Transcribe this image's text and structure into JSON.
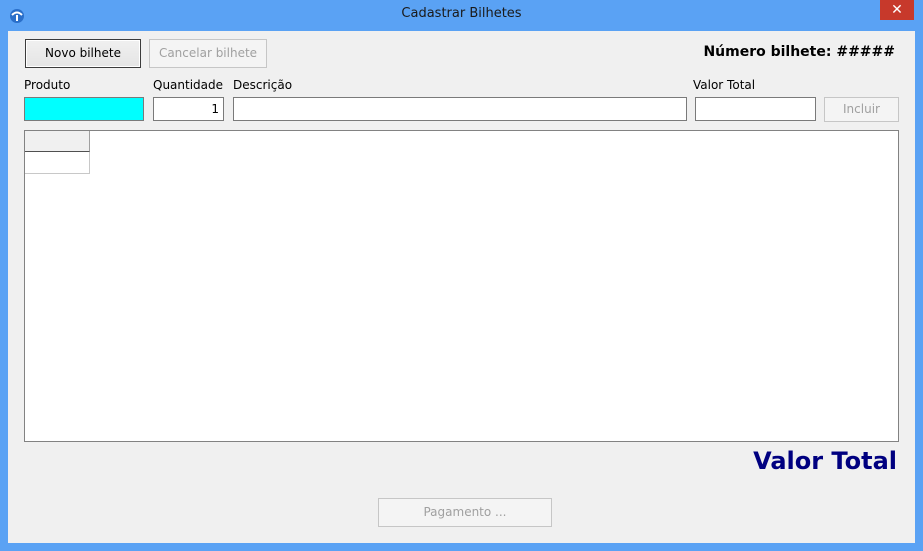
{
  "window": {
    "title": "Cadastrar Bilhetes",
    "close_glyph": "✕",
    "icon": "app-icon"
  },
  "toolbar": {
    "novo_label": "Novo bilhete",
    "cancelar_label": "Cancelar bilhete"
  },
  "ticket_number": {
    "text": "Número bilhete: #####"
  },
  "form": {
    "produto_label": "Produto",
    "quantidade_label": "Quantidade",
    "quantidade_value": "1",
    "descricao_label": "Descrição",
    "valor_total_label": "Valor Total",
    "incluir_label": "Incluir"
  },
  "total": {
    "text": "Valor Total",
    "color": "#000080"
  },
  "footer": {
    "pagamento_label": "Pagamento ..."
  },
  "colors": {
    "produto_bg": "#00ffff",
    "titlebar": "#5aa2f4",
    "close": "#c7392b"
  }
}
